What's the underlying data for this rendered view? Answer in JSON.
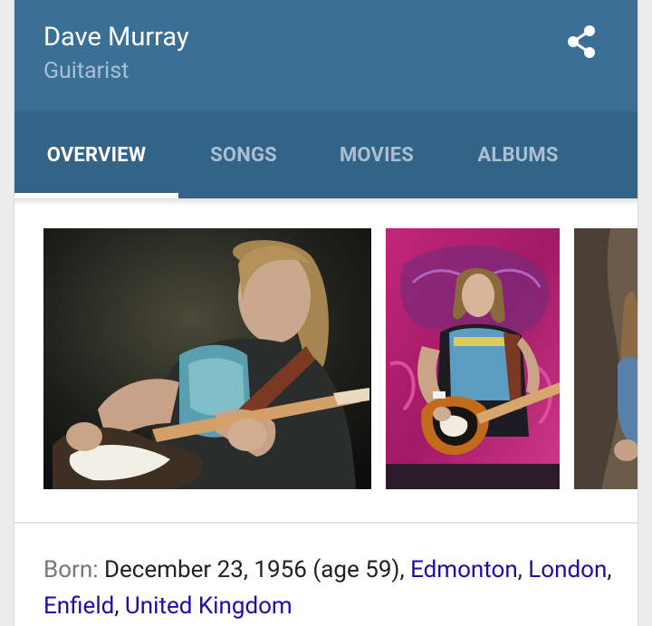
{
  "header": {
    "title": "Dave Murray",
    "subtitle": "Guitarist",
    "share_icon": "share-icon"
  },
  "tabs": [
    {
      "label": "OVERVIEW",
      "active": true
    },
    {
      "label": "SONGS",
      "active": false
    },
    {
      "label": "MOVIES",
      "active": false
    },
    {
      "label": "ALBUMS",
      "active": false
    }
  ],
  "photos": [
    {
      "description": "Guitarist with long hair playing electric guitar on stage, wearing sleeveless band shirt"
    },
    {
      "description": "Guitarist playing sunburst electric guitar in front of pink backdrop"
    },
    {
      "description": "Partially visible concert photo"
    }
  ],
  "born": {
    "label": "Born:",
    "text": " December 23, 1956 (age 59), ",
    "links": [
      "Edmonton",
      "London",
      "Enfield",
      "United Kingdom"
    ]
  },
  "colors": {
    "header": "#3a6f96",
    "tabs": "#336487",
    "link": "#1a0dab"
  }
}
